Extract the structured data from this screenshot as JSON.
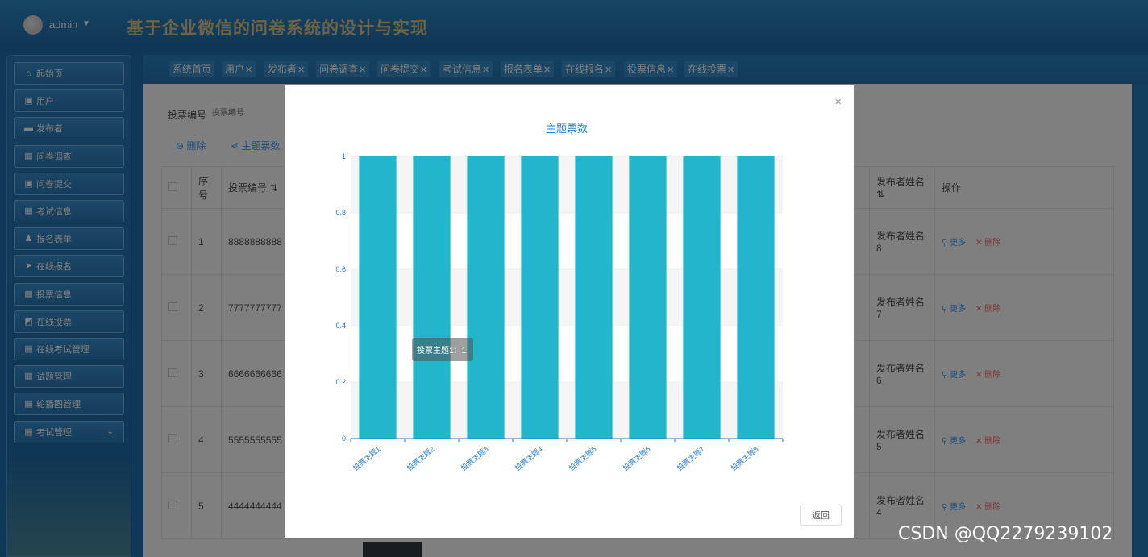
{
  "header": {
    "username": "admin",
    "title": "基于企业微信的问卷系统的设计与实现"
  },
  "sidebar": {
    "items": [
      {
        "label": "起始页",
        "icon": "home-icon",
        "glyph": "⌂"
      },
      {
        "label": "用户",
        "icon": "clipboard-icon",
        "glyph": "▣"
      },
      {
        "label": "发布者",
        "icon": "monitor-icon",
        "glyph": "▬"
      },
      {
        "label": "问卷调查",
        "icon": "grid-icon",
        "glyph": "▦"
      },
      {
        "label": "问卷提交",
        "icon": "clipboard-check-icon",
        "glyph": "▣"
      },
      {
        "label": "考试信息",
        "icon": "grid-icon",
        "glyph": "▦"
      },
      {
        "label": "报名表单",
        "icon": "user-icon",
        "glyph": "♟"
      },
      {
        "label": "在线报名",
        "icon": "paper-plane-icon",
        "glyph": "➤"
      },
      {
        "label": "投票信息",
        "icon": "grid-icon",
        "glyph": "▦"
      },
      {
        "label": "在线投票",
        "icon": "trend-chart-icon",
        "glyph": "◩"
      },
      {
        "label": "在线考试管理",
        "icon": "grid-icon",
        "glyph": "▦"
      },
      {
        "label": "试题管理",
        "icon": "grid-icon",
        "glyph": "▦"
      },
      {
        "label": "轮播图管理",
        "icon": "grid-icon",
        "glyph": "▦"
      },
      {
        "label": "考试管理",
        "icon": "grid-icon",
        "glyph": "▦"
      }
    ]
  },
  "tabs": [
    "系统首页",
    "用户",
    "发布者",
    "问卷调查",
    "问卷提交",
    "考试信息",
    "报名表单",
    "在线报名",
    "投票信息",
    "在线投票"
  ],
  "tab_close": "✕",
  "search": {
    "label": "投票编号",
    "placeholder": "投票编号"
  },
  "toolbar": {
    "delete_label": "删除",
    "chart_label": "主题票数"
  },
  "table": {
    "headers": {
      "index": "序号",
      "vote_no": "投票编号",
      "publisher_name": "发布者姓名",
      "actions": "操作"
    },
    "rows": [
      {
        "index": "1",
        "vote_no": "8888888888",
        "publisher": "发布者姓名8"
      },
      {
        "index": "2",
        "vote_no": "7777777777",
        "publisher": "发布者姓名7"
      },
      {
        "index": "3",
        "vote_no": "6666666666",
        "publisher": "发布者姓名6"
      },
      {
        "index": "4",
        "vote_no": "5555555555",
        "publisher": "发布者姓名5"
      },
      {
        "index": "5",
        "vote_no": "4444444444",
        "publisher": "发布者姓名4"
      }
    ],
    "more_label": "更多",
    "delete_label": "删除"
  },
  "dialog": {
    "return_label": "返回",
    "close": "×"
  },
  "chart_data": {
    "type": "bar",
    "title": "主题票数",
    "categories": [
      "投票主题1",
      "投票主题2",
      "投票主题3",
      "投票主题4",
      "投票主题5",
      "投票主题6",
      "投票主题7",
      "投票主题8"
    ],
    "values": [
      1,
      1,
      1,
      1,
      1,
      1,
      1,
      1
    ],
    "ylim": [
      0,
      1
    ],
    "yticks": [
      0,
      0.2,
      0.4,
      0.6,
      0.8,
      1
    ],
    "ytick_labels": [
      "0",
      "0.2",
      "0.4",
      "0.6",
      "0.8",
      "1"
    ],
    "tooltip": "投票主题1：1",
    "bar_color": "#22b5cc",
    "grid": "horizontal"
  },
  "watermark": "CSDN @QQ2279239102"
}
